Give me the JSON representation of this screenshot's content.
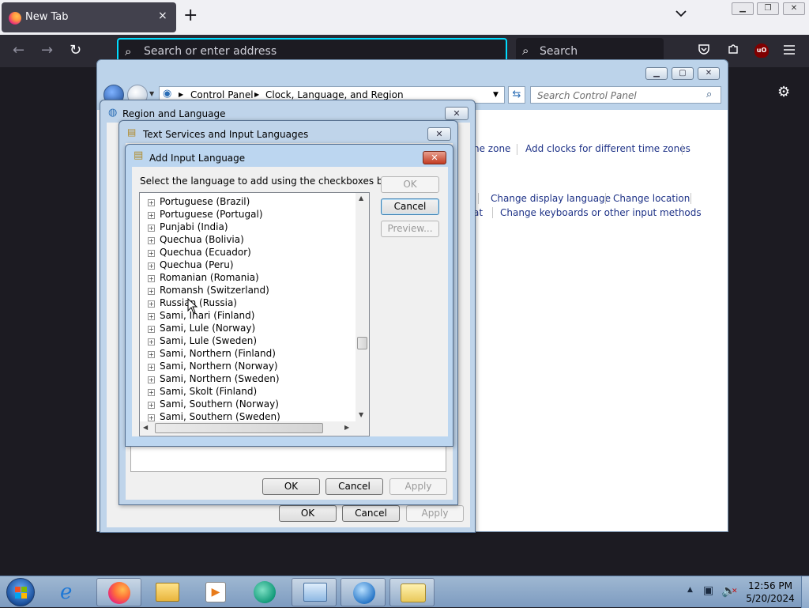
{
  "browser": {
    "tab_title": "New Tab",
    "tab_close": "×",
    "new_tab": "+",
    "list_tabs": "⌄",
    "url_placeholder": "Search or enter address",
    "search_label": "Search",
    "ublock_label": "uO"
  },
  "control_panel": {
    "breadcrumb": [
      "Control Panel",
      "Clock, Language, and Region"
    ],
    "search_placeholder": "Search Control Panel",
    "links": {
      "time_zone": "ne zone",
      "add_clocks": "Add clocks for different time zones",
      "change_display_language": "Change display language",
      "change_location": "Change location",
      "at": "at",
      "change_keyboards": "Change keyboards or other input methods"
    }
  },
  "region_dialog": {
    "title": "Region and Language",
    "ok": "OK",
    "cancel": "Cancel",
    "apply": "Apply"
  },
  "text_services_dialog": {
    "title": "Text Services and Input Languages",
    "ok": "OK",
    "cancel": "Cancel",
    "apply": "Apply"
  },
  "add_input_dialog": {
    "title": "Add Input Language",
    "instruction": "Select the language to add using the checkboxes below.",
    "ok": "OK",
    "cancel": "Cancel",
    "preview": "Preview...",
    "languages": [
      "Portuguese (Brazil)",
      "Portuguese (Portugal)",
      "Punjabi (India)",
      "Quechua (Bolivia)",
      "Quechua (Ecuador)",
      "Quechua (Peru)",
      "Romanian (Romania)",
      "Romansh (Switzerland)",
      "Russian (Russia)",
      "Sami, Inari (Finland)",
      "Sami, Lule (Norway)",
      "Sami, Lule (Sweden)",
      "Sami, Northern (Finland)",
      "Sami, Northern (Norway)",
      "Sami, Northern (Sweden)",
      "Sami, Skolt (Finland)",
      "Sami, Southern (Norway)",
      "Sami, Southern (Sweden)"
    ]
  },
  "taskbar": {
    "time": "12:56 PM",
    "date": "5/20/2024"
  }
}
